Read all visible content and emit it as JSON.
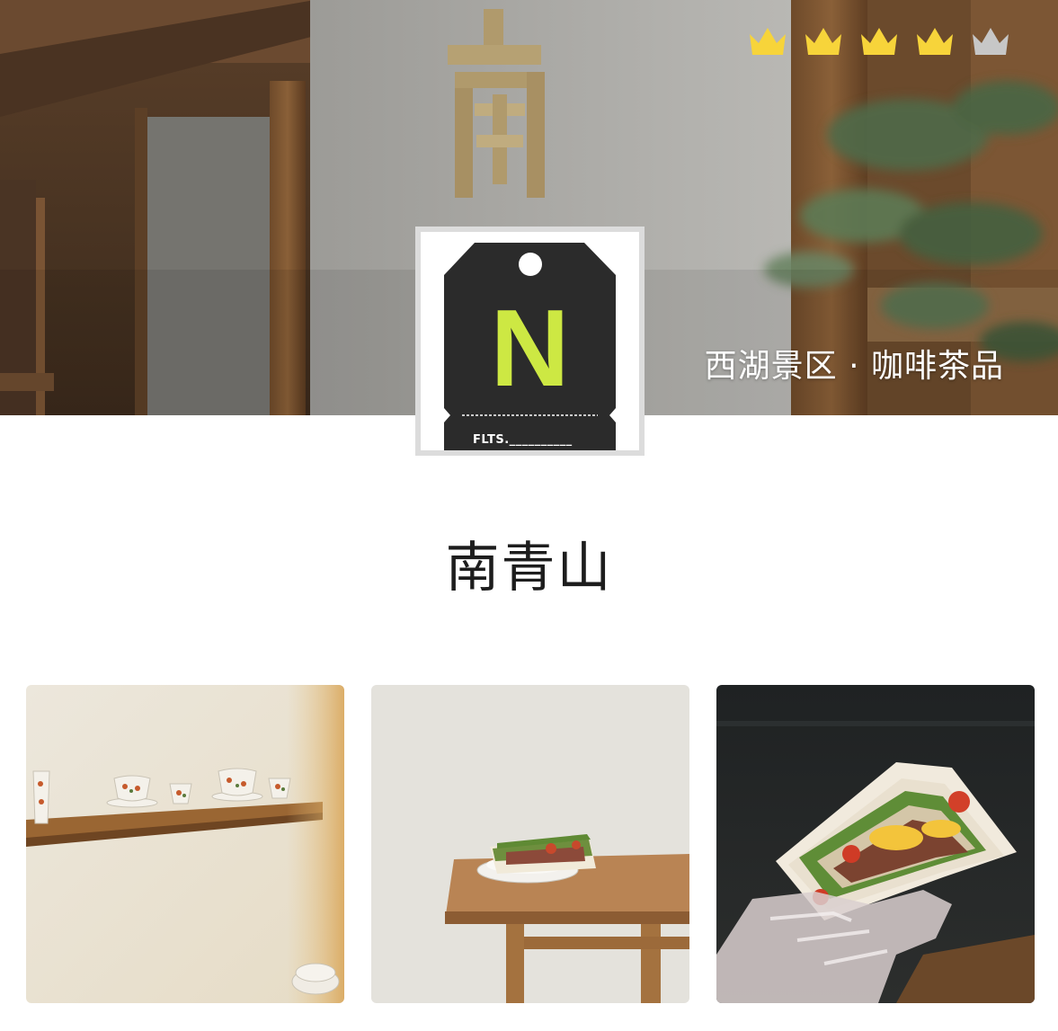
{
  "shop": {
    "name": "南青山",
    "tagline": "西湖景区 · 咖啡茶品",
    "logo": {
      "letter": "N",
      "caption": "FLTS.__________",
      "letter_color": "#cde843",
      "tag_color": "#2b2b2b"
    }
  },
  "rating": {
    "score": 4,
    "max": 5,
    "icon": "crown-icon",
    "active_color": "#f7d43a",
    "inactive_color": "#c7c7c7"
  },
  "photos": [
    {
      "icon": "tea-shelf-photo"
    },
    {
      "icon": "sandwich-on-table-photo"
    },
    {
      "icon": "sandwich-in-hand-photo"
    }
  ]
}
